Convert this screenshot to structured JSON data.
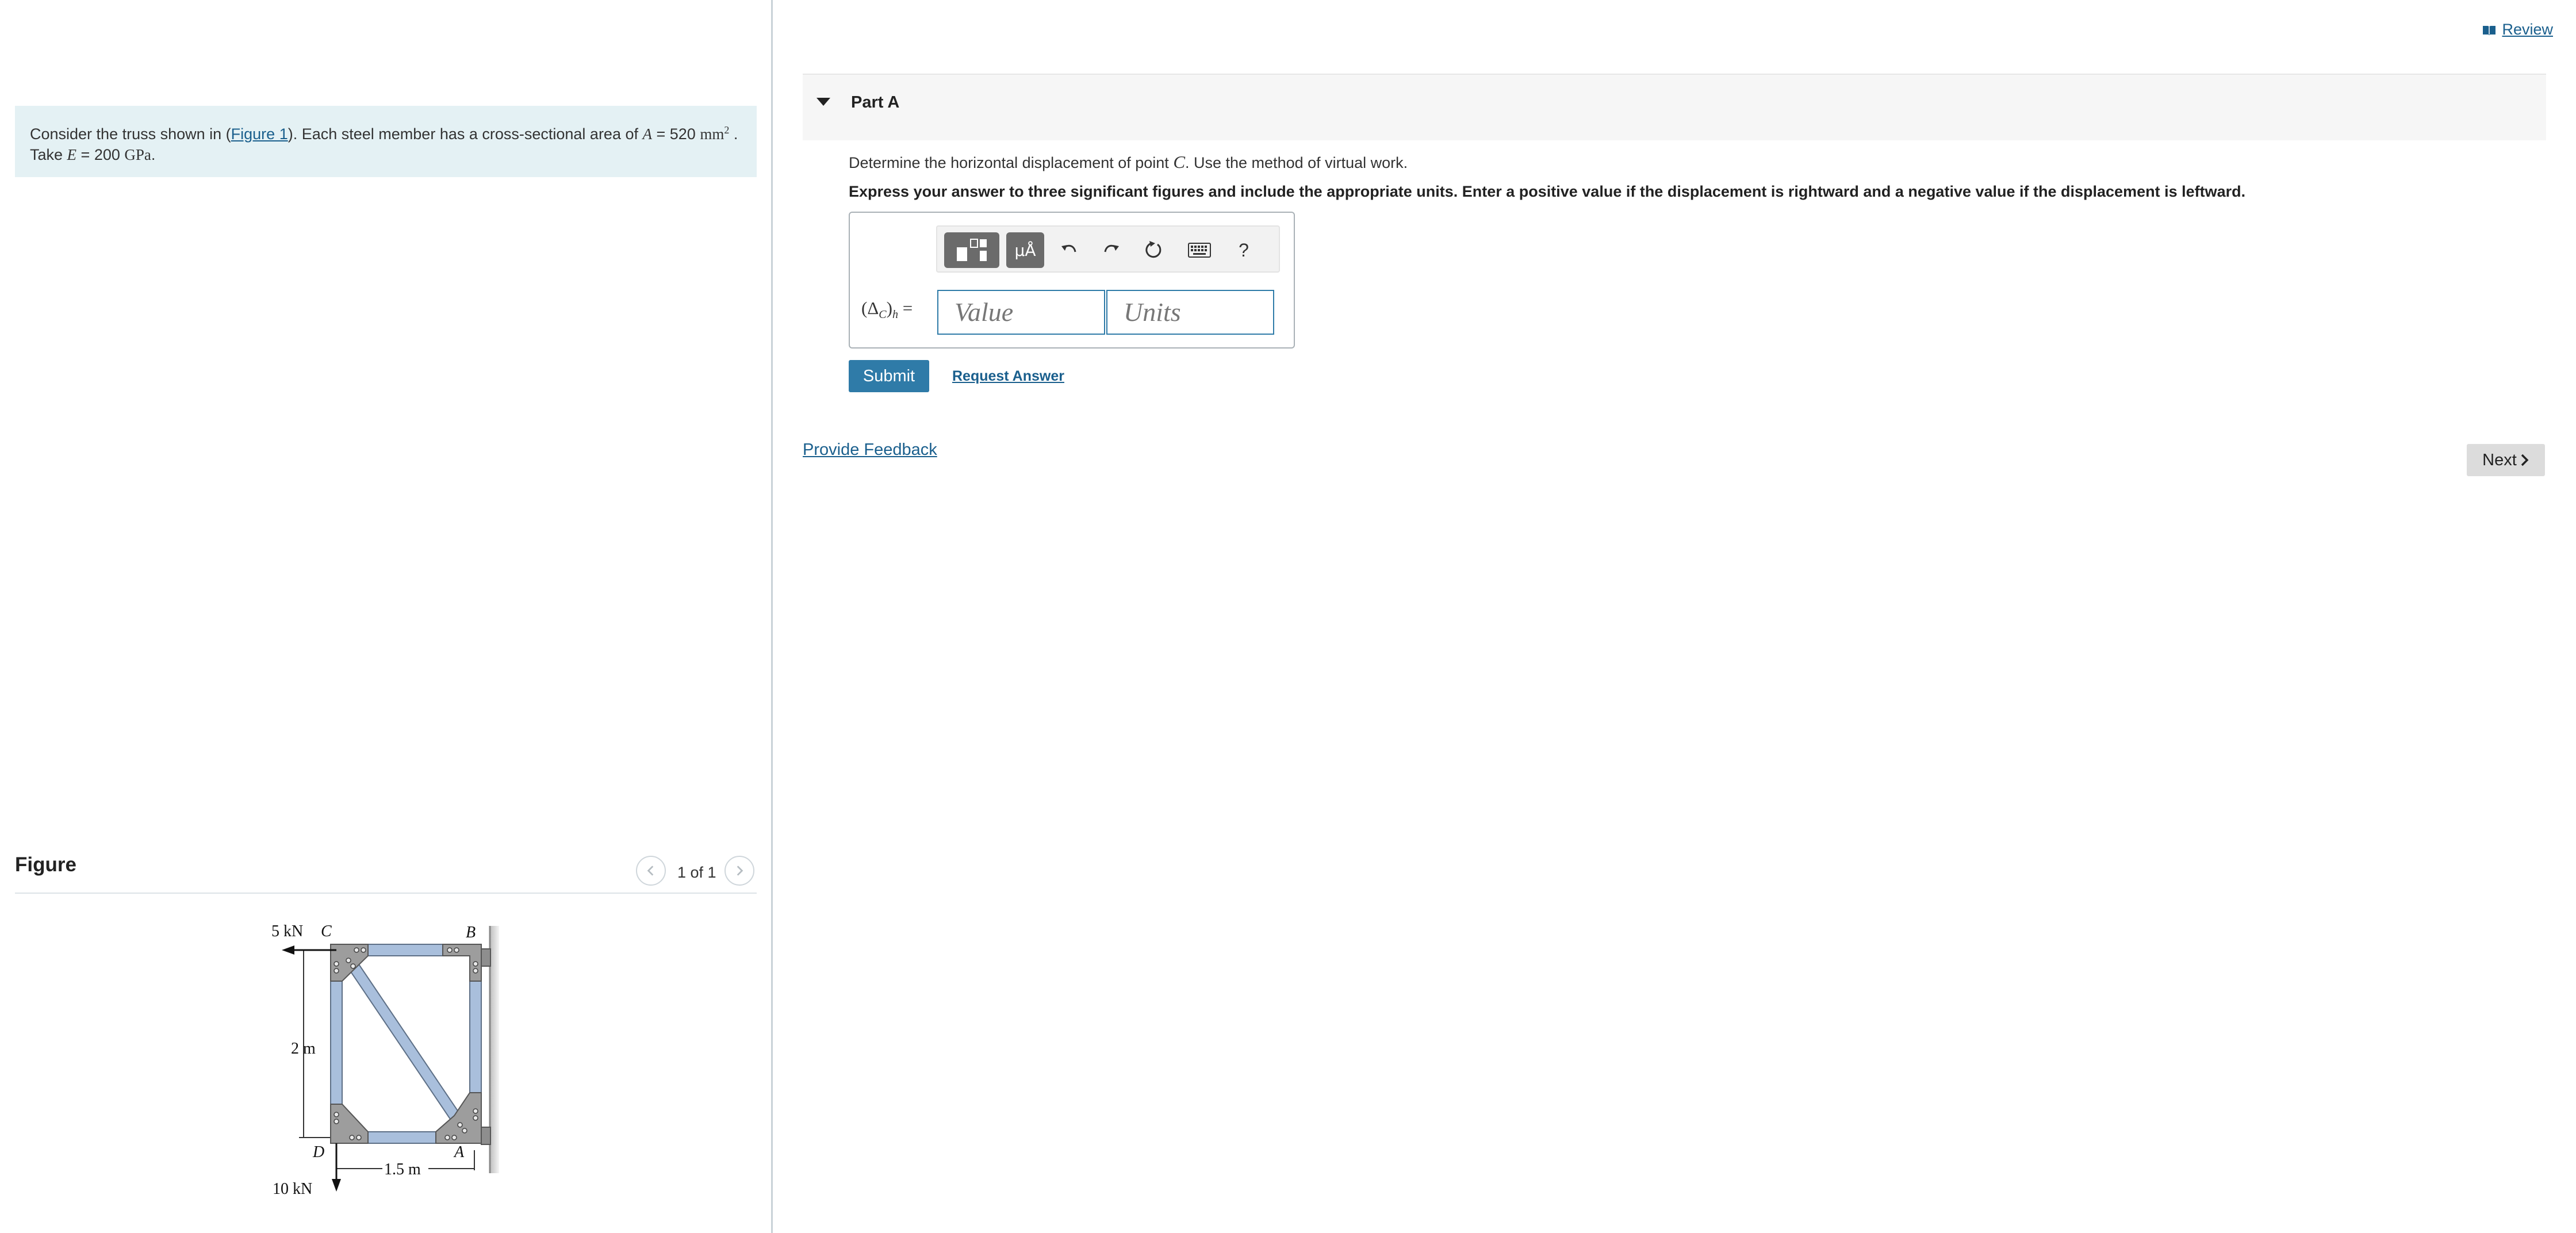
{
  "problem": {
    "text_before_link": "Consider the truss shown in (",
    "figure_link": "Figure 1",
    "text_after_link": "). Each steel member has a cross-sectional area of ",
    "area_symbol": "A",
    "area_eq": " = 520 ",
    "area_unit": "mm",
    "area_exp": "2",
    "take_text": "Take ",
    "modulus_symbol": "E",
    "modulus_eq": " = 200 ",
    "modulus_unit": "GPa"
  },
  "figure": {
    "heading": "Figure",
    "counter": "1 of 1",
    "labels": {
      "load_c": "5 kN",
      "point_c": "C",
      "point_b": "B",
      "height": "2 m",
      "point_d": "D",
      "point_a": "A",
      "width": "1.5 m",
      "load_d": "10 kN"
    }
  },
  "review_link": "Review",
  "part": {
    "title": "Part A",
    "question_prefix": "Determine the horizontal displacement of point ",
    "question_point": "C",
    "question_suffix": ". Use the method of virtual work.",
    "instruction": "Express your answer to three significant figures and include the appropriate units. Enter a positive value if the displacement is rightward and a negative value if the displacement is leftward.",
    "answer_label": "(Δ",
    "answer_sub": "C",
    "answer_sub2": "h",
    "value_placeholder": "Value",
    "units_placeholder": "Units",
    "units_button": "μÅ",
    "help_button": "?",
    "submit": "Submit",
    "request_answer": "Request Answer"
  },
  "provide_feedback": "Provide Feedback",
  "next": "Next"
}
